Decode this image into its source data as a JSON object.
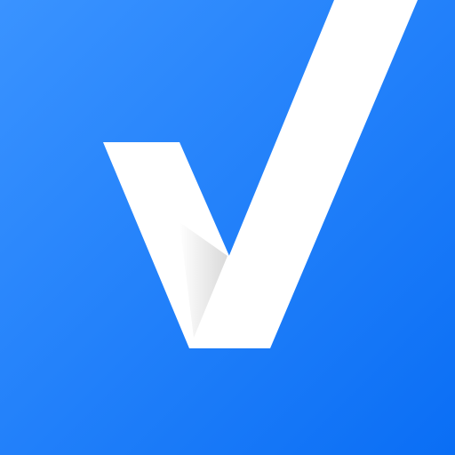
{
  "icon": {
    "name": "checkmark-icon",
    "colors": {
      "background_top_left": "#3a93ff",
      "background_bottom_right": "#0a6ef5",
      "mark": "#ffffff",
      "fold_shadow": "#d9d9d9"
    }
  }
}
